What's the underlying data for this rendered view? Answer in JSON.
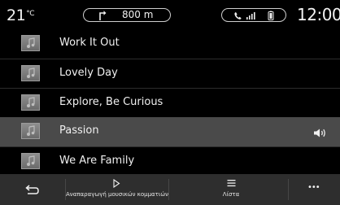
{
  "status": {
    "temperature": "21",
    "temperature_unit": "°C",
    "navigation_distance": "800 m",
    "time": "12:00"
  },
  "playlist": {
    "tracks": [
      {
        "title": "Work It Out",
        "active": false
      },
      {
        "title": "Lovely Day",
        "active": false
      },
      {
        "title": "Explore, Be Curious",
        "active": false
      },
      {
        "title": "Passion",
        "active": true
      },
      {
        "title": "We Are Family",
        "active": false
      }
    ]
  },
  "bottom_bar": {
    "play_label": "Αναπαραγωγή μουσικών κομματιών",
    "list_label": "Λίστα",
    "more_label": "•••"
  },
  "icons": {
    "status": [
      "turn-right-arrow-icon",
      "phone-icon",
      "signal-icon",
      "battery-icon"
    ],
    "rows": [
      "music-note-icon",
      "speaker-icon"
    ],
    "bottom": [
      "back-arrow-icon",
      "play-icon",
      "list-icon",
      "more-icon"
    ]
  },
  "colors": {
    "background": "#000000",
    "active_row": "#4a4a4a",
    "bottom_bar": "#2e2e2e",
    "text": "#f0f0f0"
  }
}
